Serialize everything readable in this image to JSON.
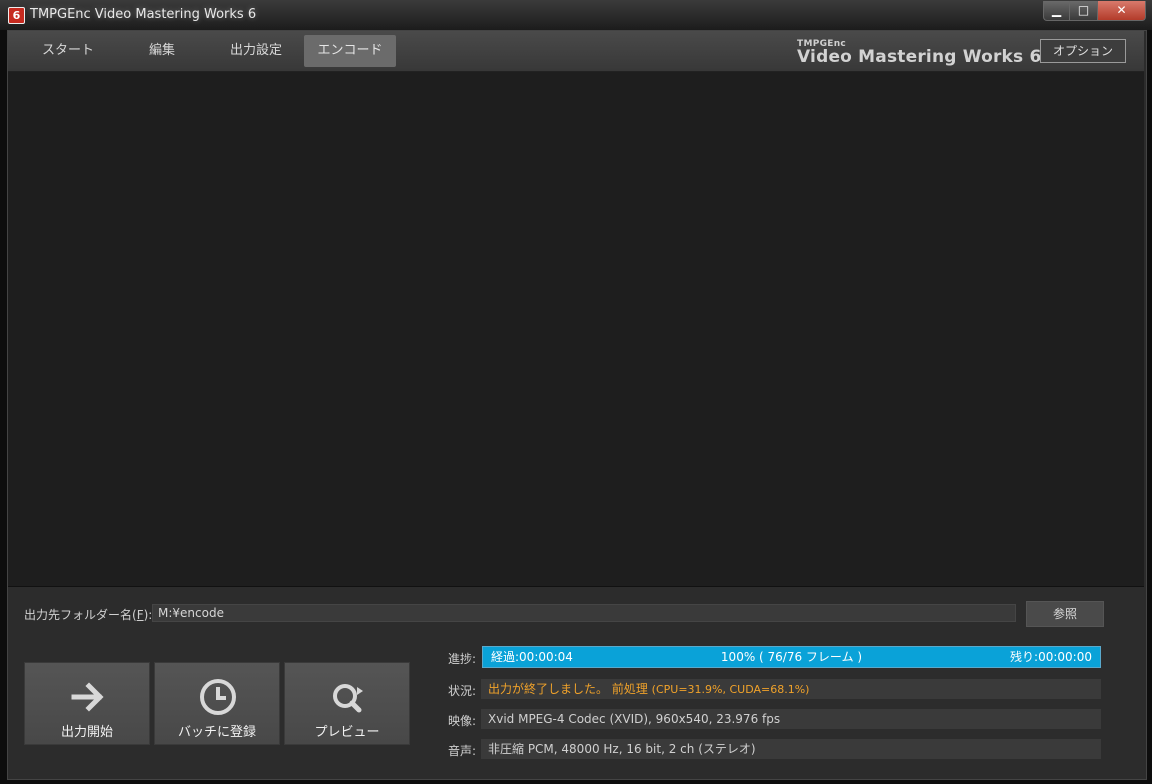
{
  "window": {
    "title": "TMPGEnc Video Mastering Works 6",
    "icon_glyph": "6",
    "controls": {
      "minimize": "▁",
      "maximize": "□",
      "close": "✕"
    }
  },
  "nav": {
    "tabs": [
      {
        "label": "スタート"
      },
      {
        "label": "編集"
      },
      {
        "label": "出力設定"
      },
      {
        "label": "エンコード",
        "active": true
      }
    ],
    "brand_small": "TMPGEnc",
    "brand_big": "Video Mastering Works 6",
    "options_label": "オプション"
  },
  "output": {
    "folder_label_pre": "出力先フォルダー名(",
    "folder_label_key": "F",
    "folder_label_post": "):",
    "folder_value": "M:¥encode",
    "browse_label": "参照"
  },
  "actions": {
    "start_label": "出力開始",
    "batch_label": "バッチに登録",
    "preview_label": "プレビュー"
  },
  "info": {
    "progress_label": "進捗:",
    "elapsed": "経過:00:00:04",
    "progress_center": "100% ( 76/76 フレーム )",
    "remaining": "残り:00:00:00",
    "progress_fraction": 1.0,
    "status_label": "状況:",
    "status_main": "出力が終了しました。 前処理",
    "status_detail": "(CPU=31.9%, CUDA=68.1%)",
    "video_label": "映像:",
    "video_value": "Xvid MPEG-4 Codec (XVID), 960x540, 23.976 fps",
    "audio_label": "音声:",
    "audio_value": "非圧縮 PCM, 48000 Hz, 16 bit, 2 ch (ステレオ)"
  },
  "colors": {
    "progress_fill": "#0aa2d8",
    "status_text": "#f0a22a"
  }
}
